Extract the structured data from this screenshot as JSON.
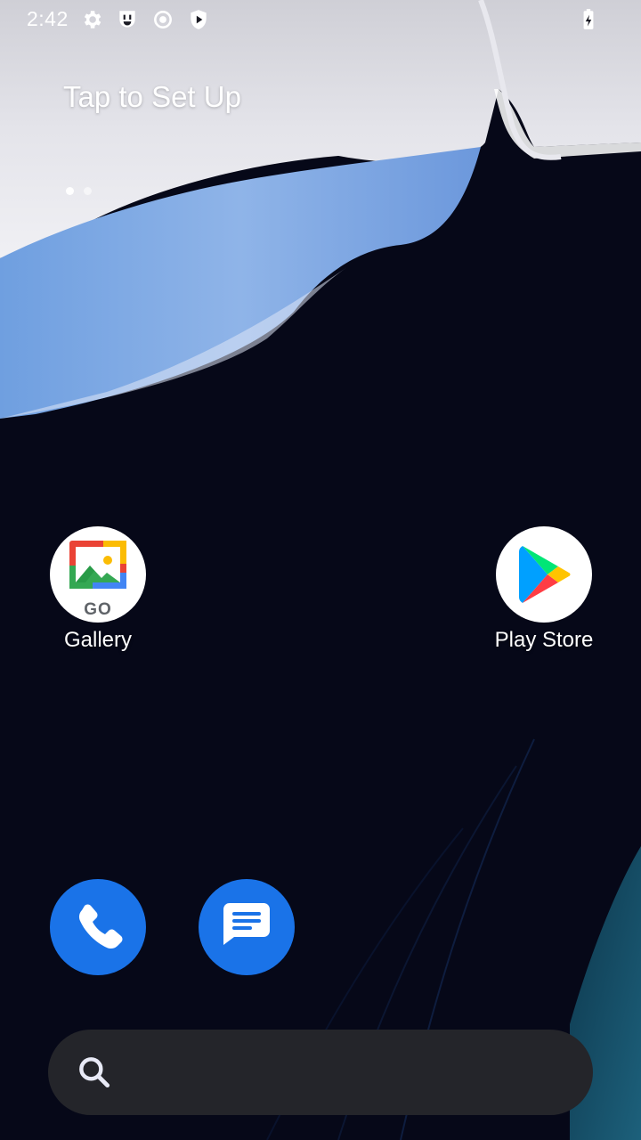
{
  "status_bar": {
    "time": "2:42",
    "icons": [
      "settings-icon",
      "shield-face-icon",
      "record-icon",
      "play-protect-icon",
      "battery-charging-icon"
    ]
  },
  "home": {
    "setup_prompt": "Tap to Set Up",
    "page_indicator": {
      "count": 2,
      "active": 1
    }
  },
  "apps": [
    {
      "label": "Gallery",
      "icon": "gallery-go-icon",
      "badge_text": "GO"
    },
    {
      "label": "Play Store",
      "icon": "play-store-icon"
    }
  ],
  "dock": [
    {
      "icon": "phone-icon",
      "color": "#1a73e8"
    },
    {
      "icon": "messages-icon",
      "color": "#1a73e8"
    }
  ],
  "search": {
    "icon": "search-icon",
    "placeholder": ""
  }
}
